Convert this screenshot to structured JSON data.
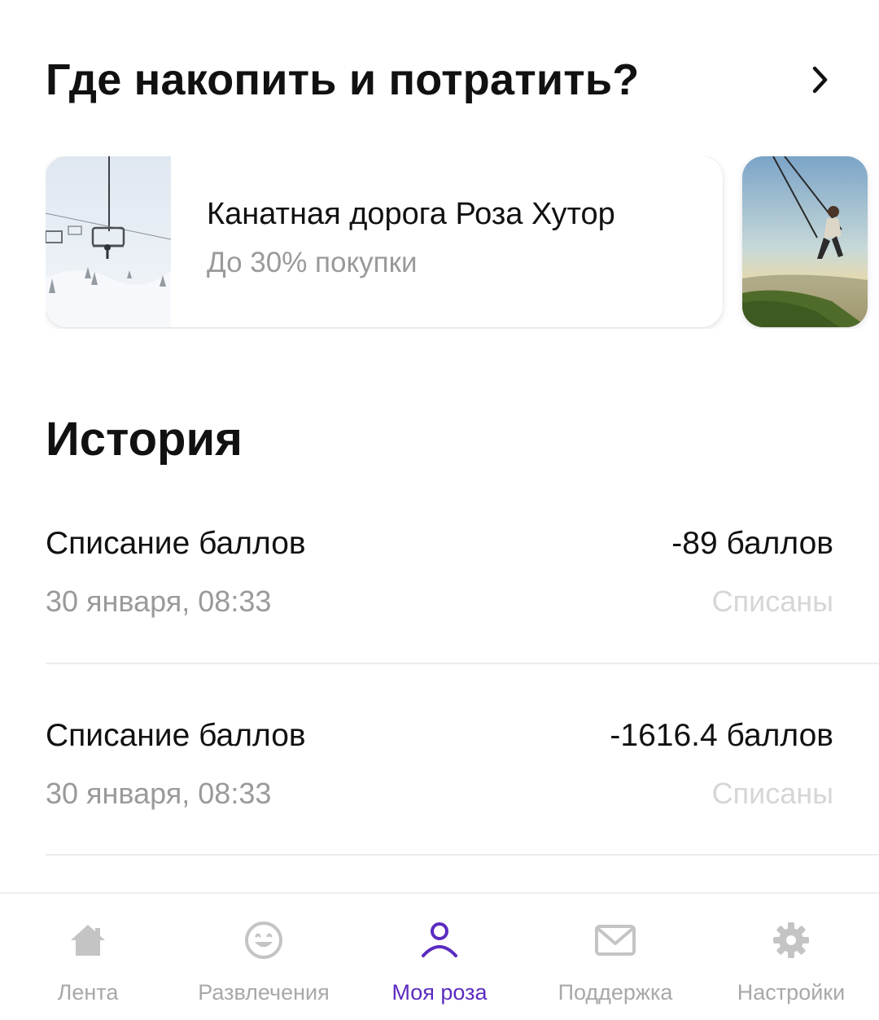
{
  "earn_section": {
    "title": "Где накопить и потратить?"
  },
  "places": [
    {
      "title": "Канатная дорога Роза Хутор",
      "subtitle": "До 30% покупки",
      "image": "ski-lift-photo"
    },
    {
      "image": "swing-mountain-photo"
    }
  ],
  "history": {
    "title": "История",
    "items": [
      {
        "name": "Списание баллов",
        "amount": "-89 баллов",
        "date": "30 января, 08:33",
        "status": "Списаны"
      },
      {
        "name": "Списание баллов",
        "amount": "-1616.4 баллов",
        "date": "30 января, 08:33",
        "status": "Списаны"
      }
    ]
  },
  "nav": {
    "items": [
      {
        "label": "Лента",
        "icon": "home-icon"
      },
      {
        "label": "Развлечения",
        "icon": "smile-icon"
      },
      {
        "label": "Моя роза",
        "icon": "person-icon",
        "active": true
      },
      {
        "label": "Поддержка",
        "icon": "mail-icon"
      },
      {
        "label": "Настройки",
        "icon": "gear-icon"
      }
    ]
  },
  "colors": {
    "accent": "#5b2bc0",
    "text_primary": "#111111",
    "text_secondary": "#9a9a9a",
    "text_muted": "#d6d6d6",
    "nav_inactive": "#a8a8a8"
  }
}
